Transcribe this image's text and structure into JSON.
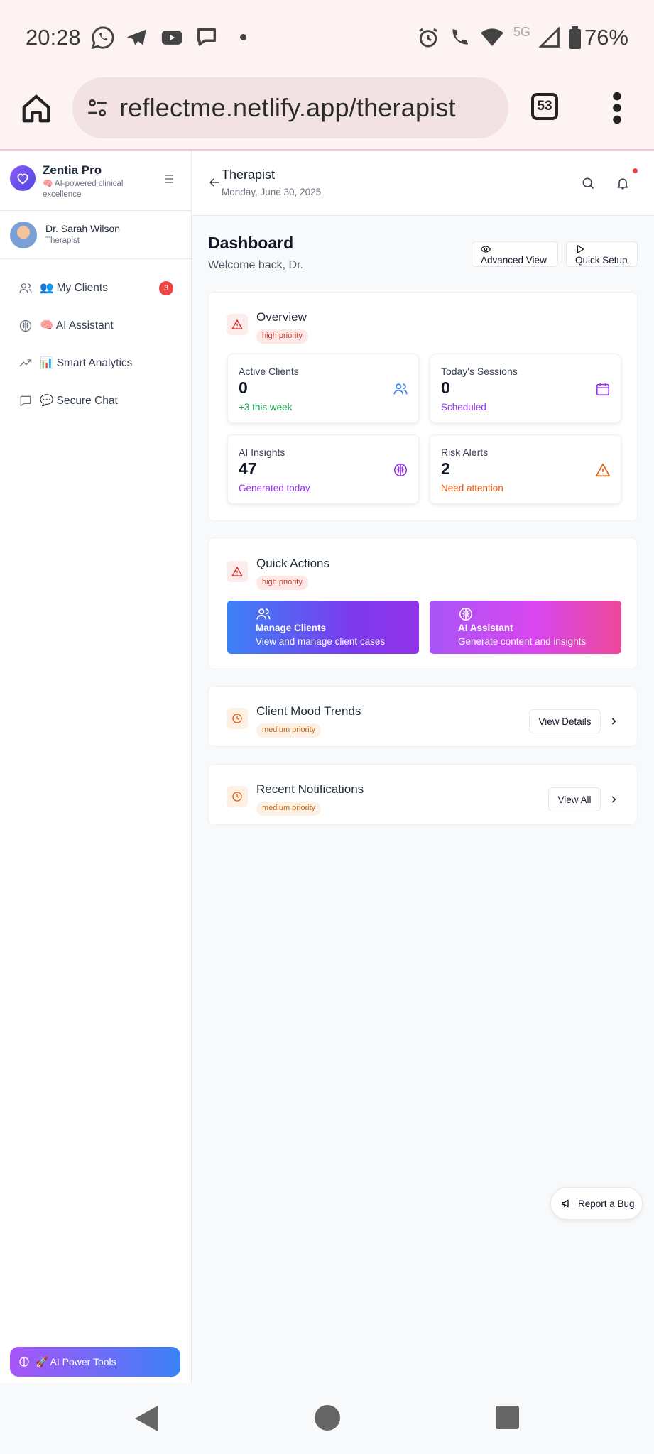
{
  "status_bar": {
    "time": "20:28",
    "network": "5G",
    "battery": "76%"
  },
  "browser": {
    "url": "reflectme.netlify.app/therapist",
    "tab_count": "53"
  },
  "sidebar": {
    "brand_name": "Zentia Pro",
    "brand_tagline": "🧠 AI-powered clinical excellence",
    "user_name": "Dr. Sarah Wilson",
    "user_role": "Therapist",
    "items": [
      {
        "label": "👥 My Clients",
        "badge": "3",
        "icon": "users-icon"
      },
      {
        "label": "🧠 AI Assistant",
        "icon": "brain-icon"
      },
      {
        "label": "📊 Smart Analytics",
        "icon": "trending-up-icon"
      },
      {
        "label": "💬 Secure Chat",
        "icon": "chat-icon"
      }
    ],
    "power_tools_label": "🚀 AI Power Tools"
  },
  "header": {
    "title": "Therapist",
    "date": "Monday, June 30, 2025"
  },
  "dashboard": {
    "title": "Dashboard",
    "welcome": "Welcome back, Dr.",
    "advanced_view_label": "Advanced View",
    "quick_setup_label": "Quick Setup"
  },
  "overview": {
    "title": "Overview",
    "priority": "high priority",
    "stats": [
      {
        "label": "Active Clients",
        "value": "0",
        "sub": "+3 this week",
        "sub_color": "#16a34a",
        "icon": "users-icon",
        "icon_color": "#3b82f6"
      },
      {
        "label": "Today's Sessions",
        "value": "0",
        "sub": "Scheduled",
        "sub_color": "#9333ea",
        "icon": "calendar-icon",
        "icon_color": "#9333ea"
      },
      {
        "label": "AI Insights",
        "value": "47",
        "sub": "Generated today",
        "sub_color": "#9333ea",
        "icon": "brain-icon",
        "icon_color": "#9333ea"
      },
      {
        "label": "Risk Alerts",
        "value": "2",
        "sub": "Need attention",
        "sub_color": "#ea580c",
        "icon": "alert-icon",
        "icon_color": "#ea580c"
      }
    ]
  },
  "quick_actions": {
    "title": "Quick Actions",
    "priority": "high priority",
    "actions": [
      {
        "title": "Manage Clients",
        "subtitle": "View and manage client cases"
      },
      {
        "title": "AI Assistant",
        "subtitle": "Generate content and insights"
      }
    ]
  },
  "mood_trends": {
    "title": "Client Mood Trends",
    "priority": "medium priority",
    "button": "View Details"
  },
  "notifications": {
    "title": "Recent Notifications",
    "priority": "medium priority",
    "button": "View All"
  },
  "report_bug_label": "Report a Bug",
  "colors": {
    "high_priority": "#dc2626",
    "medium_priority": "#ea580c",
    "accent": "#7c3aed"
  }
}
